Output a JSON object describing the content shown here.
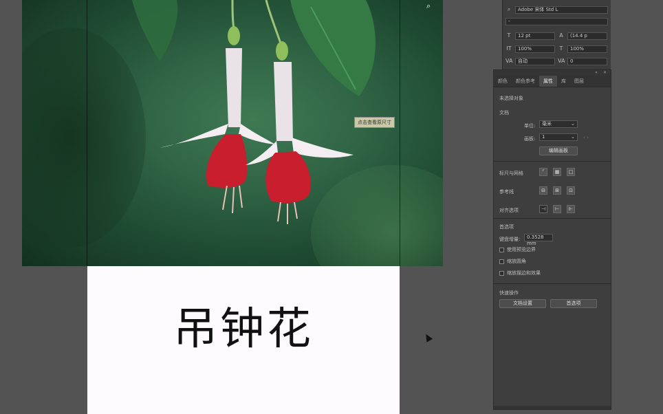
{
  "canvas": {
    "title_text": "吊钟花",
    "tooltip": "点击查看原尺寸"
  },
  "character_panel": {
    "font_family": "Adobe 宋体 Std L",
    "font_style": "-",
    "font_size": "12 pt",
    "leading": "(14.4 p",
    "vertical_scale": "100%",
    "horizontal_scale": "100%",
    "kerning": "自动",
    "tracking": "0"
  },
  "properties_panel": {
    "tabs": [
      "颜色",
      "颜色参考",
      "属性",
      "库",
      "图层"
    ],
    "active_tab": "属性",
    "no_selection": "未选择对象",
    "document_section": "文档",
    "units_label": "单位:",
    "units_value": "毫米",
    "artboard_label": "画板:",
    "artboard_value": "1",
    "edit_artboard_button": "编辑画板",
    "rulers_grids_label": "标尺与网格",
    "guides_label": "参考线",
    "snap_label": "对齐选项",
    "preferences_section": "首选项",
    "keyboard_increment_label": "键盘增量:",
    "keyboard_increment_value": "0.3528 mm",
    "checkboxes": [
      "使用预览边界",
      "缩放圆角",
      "缩放描边和效果"
    ],
    "quick_actions_section": "快速操作",
    "document_setup_button": "文档设置",
    "preferences_button": "首选项"
  }
}
